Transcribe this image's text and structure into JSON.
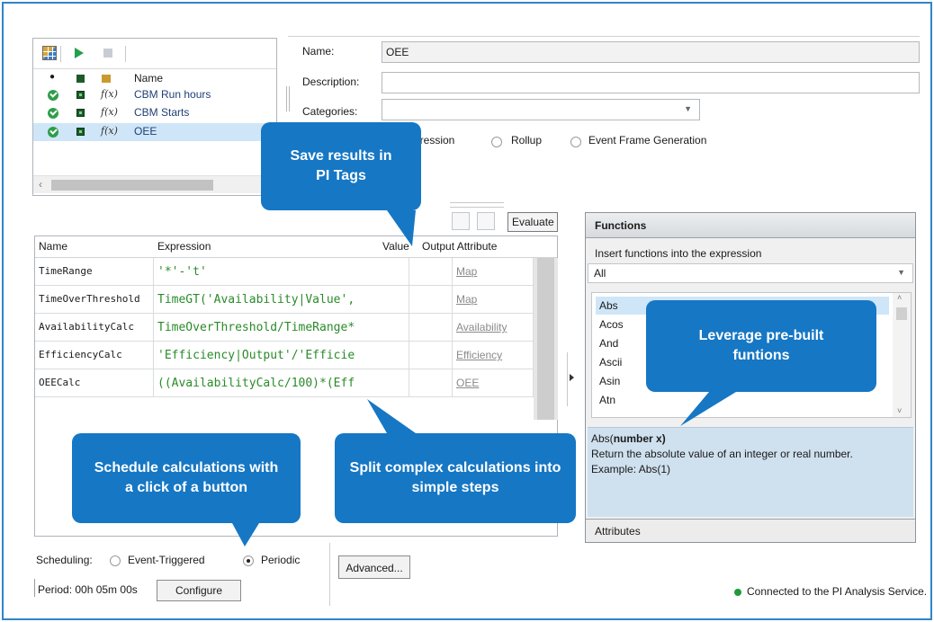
{
  "analyses": {
    "columns": [
      "Name"
    ],
    "items": [
      {
        "name": "CBM Run hours",
        "selected": false
      },
      {
        "name": "CBM Starts",
        "selected": false
      },
      {
        "name": "OEE",
        "selected": true
      }
    ],
    "fx_label": "f(x)"
  },
  "properties": {
    "name_label": "Name:",
    "name_value": "OEE",
    "description_label": "Description:",
    "description_value": "",
    "categories_label": "Categories:",
    "categories_value": "",
    "type_options": [
      {
        "label": "Expression",
        "partial": "pression",
        "selected": true
      },
      {
        "label": "Rollup",
        "selected": false
      },
      {
        "label": "Event Frame Generation",
        "selected": false
      }
    ]
  },
  "evaluate_label": "Evaluate",
  "variable_table": {
    "headers": [
      "Name",
      "Expression",
      "Value",
      "Output Attribute"
    ],
    "rows": [
      {
        "name": "TimeRange",
        "expression": "'*'-'t'",
        "value": "",
        "output": "Map"
      },
      {
        "name": "TimeOverThreshold",
        "expression": "TimeGT('Availability|Value',",
        "value": "",
        "output": "Map"
      },
      {
        "name": "AvailabilityCalc",
        "expression": "TimeOverThreshold/TimeRange*",
        "value": "",
        "output": "Availability"
      },
      {
        "name": "EfficiencyCalc",
        "expression": "'Efficiency|Output'/'Efficie",
        "value": "",
        "output": "Efficiency"
      },
      {
        "name": "OEECalc",
        "expression": "((AvailabilityCalc/100)*(Eff",
        "value": "",
        "output": "OEE"
      }
    ]
  },
  "functions": {
    "title": "Functions",
    "subtitle": "Insert functions into the expression",
    "filter": "All",
    "items": [
      "Abs",
      "Acos",
      "And",
      "Ascii",
      "Asin",
      "Atn"
    ],
    "selected": "Abs",
    "desc_name": "Abs(",
    "desc_param": "number x",
    "desc_close": ")",
    "desc_text": "Return the absolute value of an integer or real number.",
    "desc_example": "Example: Abs(1)",
    "attributes_label": "Attributes"
  },
  "scheduling": {
    "label": "Scheduling:",
    "options": [
      {
        "label": "Event-Triggered",
        "selected": false
      },
      {
        "label": "Periodic",
        "selected": true
      }
    ],
    "period_text": "Period: 00h 05m 00s",
    "configure_label": "Configure",
    "advanced_label": "Advanced..."
  },
  "status": {
    "text": "Connected to the PI Analysis Service.",
    "color": "#1e9b3a"
  },
  "callouts": {
    "save_results": "Save results in PI Tags",
    "prebuilt": "Leverage pre-built funtions",
    "schedule": "Schedule calculations with a click of a button",
    "split": "Split complex calculations into simple steps"
  },
  "colors": {
    "accent": "#1677c4",
    "frame": "#2e86c8",
    "selection": "#cfe6f8",
    "expression": "#2a8a2a"
  }
}
